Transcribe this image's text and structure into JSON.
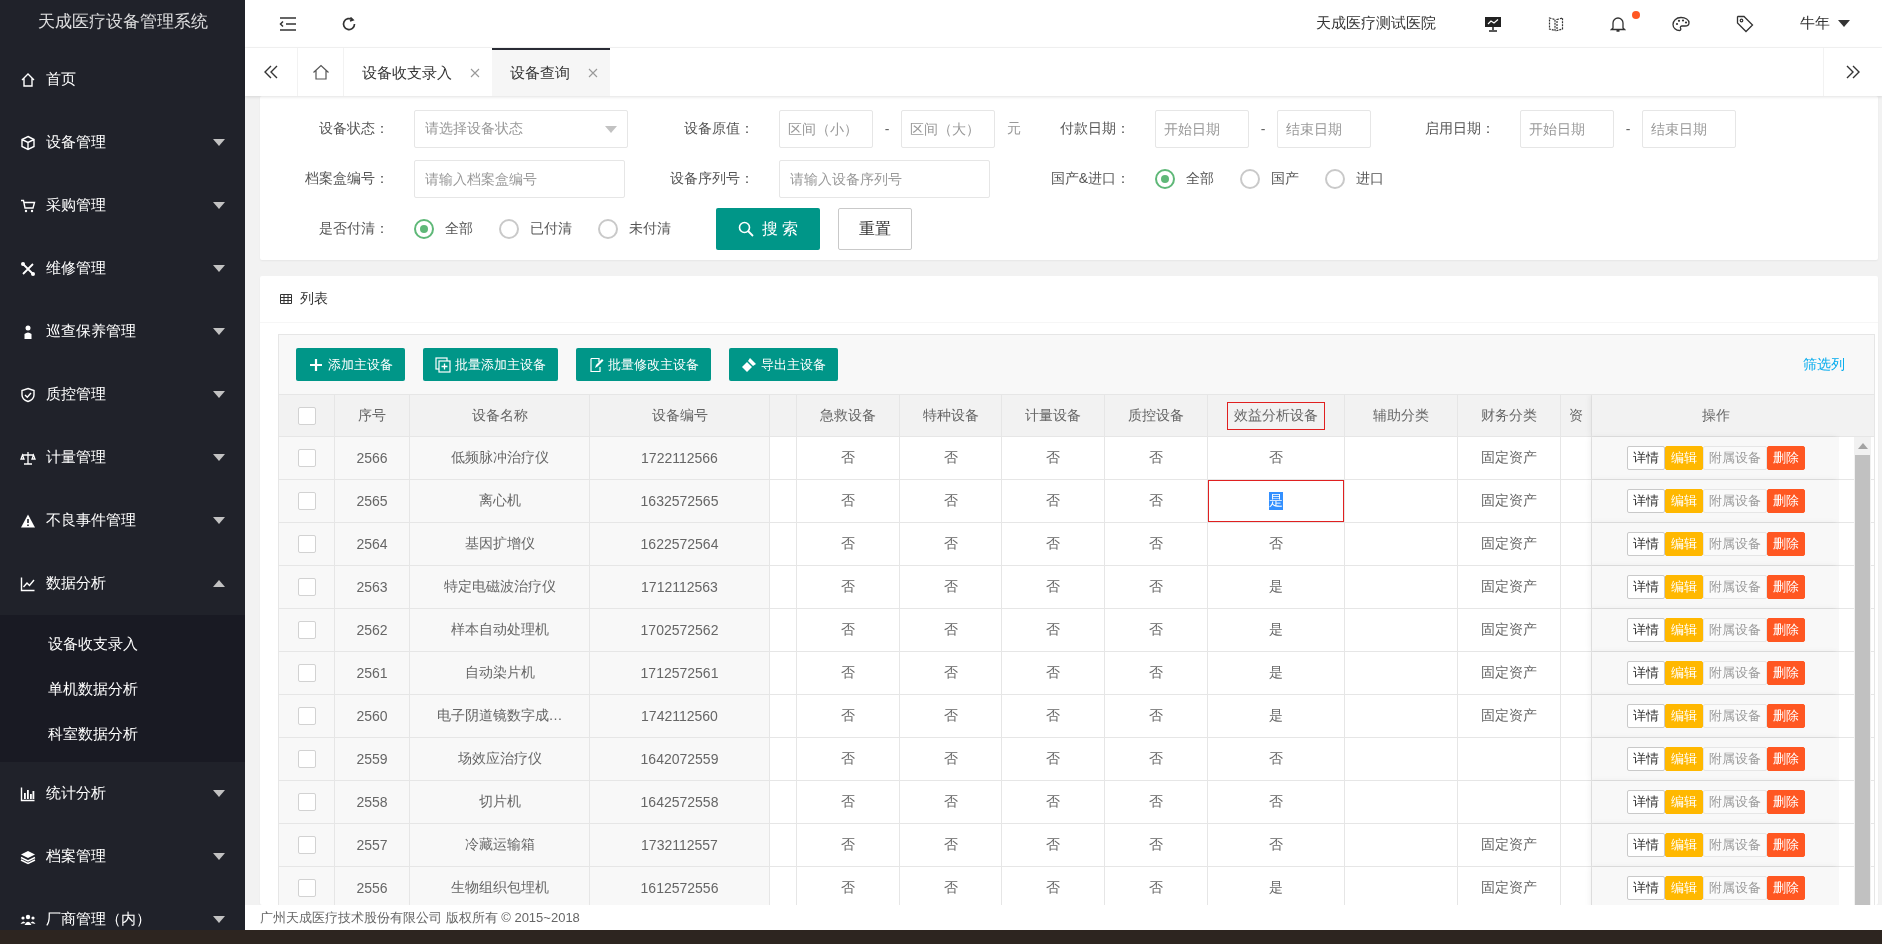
{
  "logo": {
    "title": "天成医疗设备管理系统"
  },
  "sidebar": {
    "items": [
      {
        "label": "首页"
      },
      {
        "label": "设备管理",
        "expanded": false
      },
      {
        "label": "采购管理",
        "expanded": false
      },
      {
        "label": "维修管理",
        "expanded": false
      },
      {
        "label": "巡查保养管理",
        "expanded": false
      },
      {
        "label": "质控管理",
        "expanded": false
      },
      {
        "label": "计量管理",
        "expanded": false
      },
      {
        "label": "不良事件管理",
        "expanded": false
      },
      {
        "label": "数据分析",
        "expanded": true,
        "children": [
          {
            "label": "设备收支录入"
          },
          {
            "label": "单机数据分析"
          },
          {
            "label": "科室数据分析"
          }
        ]
      },
      {
        "label": "统计分析",
        "expanded": false
      },
      {
        "label": "档案管理",
        "expanded": false
      },
      {
        "label": "厂商管理（内）",
        "expanded": false
      }
    ]
  },
  "header": {
    "hospital": "天成医疗测试医院",
    "unread_notifications": true,
    "user": "牛年"
  },
  "tabs": [
    {
      "label": "设备收支录入",
      "selected": false
    },
    {
      "label": "设备查询",
      "selected": true
    }
  ],
  "filter_rows": [
    [
      {
        "kind": "select",
        "label": "设备状态：",
        "placeholder": "请选择设备状态"
      },
      {
        "kind": "range",
        "label": "设备原值：",
        "from_placeholder": "区间（小）",
        "separator": "-",
        "to_placeholder": "区间（大）",
        "unit": "元"
      },
      {
        "kind": "range",
        "label": "付款日期：",
        "from_placeholder": "开始日期",
        "separator": "-",
        "to_placeholder": "结束日期"
      },
      {
        "kind": "range",
        "label": "启用日期：",
        "from_placeholder": "开始日期",
        "separator": "-",
        "to_placeholder": "结束日期"
      }
    ],
    [
      {
        "kind": "text",
        "label": "档案盒编号：",
        "placeholder": "请输入档案盒编号"
      },
      {
        "kind": "text",
        "label": "设备序列号：",
        "placeholder": "请输入设备序列号"
      },
      {
        "kind": "radio",
        "label": "国产&进口：",
        "options": [
          {
            "label": "全部",
            "selected": true
          },
          {
            "label": "国产",
            "selected": false
          },
          {
            "label": "进口",
            "selected": false
          }
        ]
      }
    ],
    [
      {
        "kind": "radio",
        "label": "是否付清：",
        "options": [
          {
            "label": "全部",
            "selected": true
          },
          {
            "label": "已付清",
            "selected": false
          },
          {
            "label": "未付清",
            "selected": false
          }
        ]
      },
      {
        "kind": "buttons",
        "buttons": [
          {
            "label": "搜 索",
            "kind": "primary"
          },
          {
            "label": "重置",
            "kind": "plain"
          }
        ]
      }
    ]
  ],
  "list": {
    "title": "列表",
    "toolbar": [
      {
        "label": "添加主设备",
        "kind": "add"
      },
      {
        "label": "批量添加主设备",
        "kind": "batch-add"
      },
      {
        "label": "批量修改主设备",
        "kind": "batch-edit"
      },
      {
        "label": "导出主设备",
        "kind": "export"
      }
    ],
    "filter_columns_link": "筛选列",
    "select_all": {
      "checked": false
    },
    "columns": [
      {
        "label": "序号",
        "marked": false
      },
      {
        "label": "设备名称",
        "marked": false
      },
      {
        "label": "设备编号",
        "marked": false
      },
      {
        "label": "急救设备",
        "marked": false
      },
      {
        "label": "特种设备",
        "marked": false
      },
      {
        "label": "计量设备",
        "marked": false
      },
      {
        "label": "质控设备",
        "marked": false
      },
      {
        "label": "效益分析设备",
        "marked": true
      },
      {
        "label": "辅助分类",
        "marked": false
      },
      {
        "label": "财务分类",
        "marked": false
      },
      {
        "label": "资",
        "marked": false
      }
    ],
    "actions_header": "操作",
    "rows": [
      {
        "checked": false,
        "no": "2566",
        "name": "低频脉冲治疗仪",
        "code": "1722112566",
        "emergency": "否",
        "special": "否",
        "metering": "否",
        "qc": "否",
        "benefit": "否",
        "benefit_marked": false,
        "finance": "固定资产",
        "actions": [
          {
            "label": "详情",
            "kind": "plain",
            "disabled": false
          },
          {
            "label": "编辑",
            "kind": "warm",
            "disabled": false
          },
          {
            "label": "附属设备",
            "kind": "plain",
            "disabled": true
          },
          {
            "label": "删除",
            "kind": "danger",
            "disabled": false
          }
        ]
      },
      {
        "checked": false,
        "no": "2565",
        "name": "离心机",
        "code": "1632572565",
        "emergency": "否",
        "special": "否",
        "metering": "否",
        "qc": "否",
        "benefit": "是",
        "benefit_marked": true,
        "finance": "固定资产",
        "actions": [
          {
            "label": "详情",
            "kind": "plain",
            "disabled": false
          },
          {
            "label": "编辑",
            "kind": "warm",
            "disabled": false
          },
          {
            "label": "附属设备",
            "kind": "plain",
            "disabled": true
          },
          {
            "label": "删除",
            "kind": "danger",
            "disabled": false
          }
        ]
      },
      {
        "checked": false,
        "no": "2564",
        "name": "基因扩增仪",
        "code": "1622572564",
        "emergency": "否",
        "special": "否",
        "metering": "否",
        "qc": "否",
        "benefit": "否",
        "benefit_marked": false,
        "finance": "固定资产",
        "actions": [
          {
            "label": "详情",
            "kind": "plain",
            "disabled": false
          },
          {
            "label": "编辑",
            "kind": "warm",
            "disabled": false
          },
          {
            "label": "附属设备",
            "kind": "plain",
            "disabled": true
          },
          {
            "label": "删除",
            "kind": "danger",
            "disabled": false
          }
        ]
      },
      {
        "checked": false,
        "no": "2563",
        "name": "特定电磁波治疗仪",
        "code": "1712112563",
        "emergency": "否",
        "special": "否",
        "metering": "否",
        "qc": "否",
        "benefit": "是",
        "benefit_marked": false,
        "finance": "固定资产",
        "actions": [
          {
            "label": "详情",
            "kind": "plain",
            "disabled": false
          },
          {
            "label": "编辑",
            "kind": "warm",
            "disabled": false
          },
          {
            "label": "附属设备",
            "kind": "plain",
            "disabled": true
          },
          {
            "label": "删除",
            "kind": "danger",
            "disabled": false
          }
        ]
      },
      {
        "checked": false,
        "no": "2562",
        "name": "样本自动处理机",
        "code": "1702572562",
        "emergency": "否",
        "special": "否",
        "metering": "否",
        "qc": "否",
        "benefit": "是",
        "benefit_marked": false,
        "finance": "固定资产",
        "actions": [
          {
            "label": "详情",
            "kind": "plain",
            "disabled": false
          },
          {
            "label": "编辑",
            "kind": "warm",
            "disabled": false
          },
          {
            "label": "附属设备",
            "kind": "plain",
            "disabled": true
          },
          {
            "label": "删除",
            "kind": "danger",
            "disabled": false
          }
        ]
      },
      {
        "checked": false,
        "no": "2561",
        "name": "自动染片机",
        "code": "1712572561",
        "emergency": "否",
        "special": "否",
        "metering": "否",
        "qc": "否",
        "benefit": "是",
        "benefit_marked": false,
        "finance": "固定资产",
        "actions": [
          {
            "label": "详情",
            "kind": "plain",
            "disabled": false
          },
          {
            "label": "编辑",
            "kind": "warm",
            "disabled": false
          },
          {
            "label": "附属设备",
            "kind": "plain",
            "disabled": true
          },
          {
            "label": "删除",
            "kind": "danger",
            "disabled": false
          }
        ]
      },
      {
        "checked": false,
        "no": "2560",
        "name": "电子阴道镜数字成…",
        "code": "1742112560",
        "emergency": "否",
        "special": "否",
        "metering": "否",
        "qc": "否",
        "benefit": "是",
        "benefit_marked": false,
        "finance": "固定资产",
        "actions": [
          {
            "label": "详情",
            "kind": "plain",
            "disabled": false
          },
          {
            "label": "编辑",
            "kind": "warm",
            "disabled": false
          },
          {
            "label": "附属设备",
            "kind": "plain",
            "disabled": true
          },
          {
            "label": "删除",
            "kind": "danger",
            "disabled": false
          }
        ]
      },
      {
        "checked": false,
        "no": "2559",
        "name": "场效应治疗仪",
        "code": "1642072559",
        "emergency": "否",
        "special": "否",
        "metering": "否",
        "qc": "否",
        "benefit": "否",
        "benefit_marked": false,
        "actions": [
          {
            "label": "详情",
            "kind": "plain",
            "disabled": false
          },
          {
            "label": "编辑",
            "kind": "warm",
            "disabled": false
          },
          {
            "label": "附属设备",
            "kind": "plain",
            "disabled": true
          },
          {
            "label": "删除",
            "kind": "danger",
            "disabled": false
          }
        ]
      },
      {
        "checked": false,
        "no": "2558",
        "name": "切片机",
        "code": "1642572558",
        "emergency": "否",
        "special": "否",
        "metering": "否",
        "qc": "否",
        "benefit": "否",
        "benefit_marked": false,
        "actions": [
          {
            "label": "详情",
            "kind": "plain",
            "disabled": false
          },
          {
            "label": "编辑",
            "kind": "warm",
            "disabled": false
          },
          {
            "label": "附属设备",
            "kind": "plain",
            "disabled": true
          },
          {
            "label": "删除",
            "kind": "danger",
            "disabled": false
          }
        ]
      },
      {
        "checked": false,
        "no": "2557",
        "name": "冷藏运输箱",
        "code": "1732112557",
        "emergency": "否",
        "special": "否",
        "metering": "否",
        "qc": "否",
        "benefit": "否",
        "benefit_marked": false,
        "finance": "固定资产",
        "actions": [
          {
            "label": "详情",
            "kind": "plain",
            "disabled": false
          },
          {
            "label": "编辑",
            "kind": "warm",
            "disabled": false
          },
          {
            "label": "附属设备",
            "kind": "plain",
            "disabled": true
          },
          {
            "label": "删除",
            "kind": "danger",
            "disabled": false
          }
        ]
      },
      {
        "checked": false,
        "no": "2556",
        "name": "生物组织包埋机",
        "code": "1612572556",
        "emergency": "否",
        "special": "否",
        "metering": "否",
        "qc": "否",
        "benefit": "是",
        "benefit_marked": false,
        "finance": "固定资产",
        "actions": [
          {
            "label": "详情",
            "kind": "plain",
            "disabled": false
          },
          {
            "label": "编辑",
            "kind": "warm",
            "disabled": false
          },
          {
            "label": "附属设备",
            "kind": "plain",
            "disabled": true
          },
          {
            "label": "删除",
            "kind": "danger",
            "disabled": false
          }
        ]
      }
    ]
  },
  "footer": {
    "copyright": "广州天成医疗技术股份有限公司 版权所有 © 2015~2018"
  }
}
